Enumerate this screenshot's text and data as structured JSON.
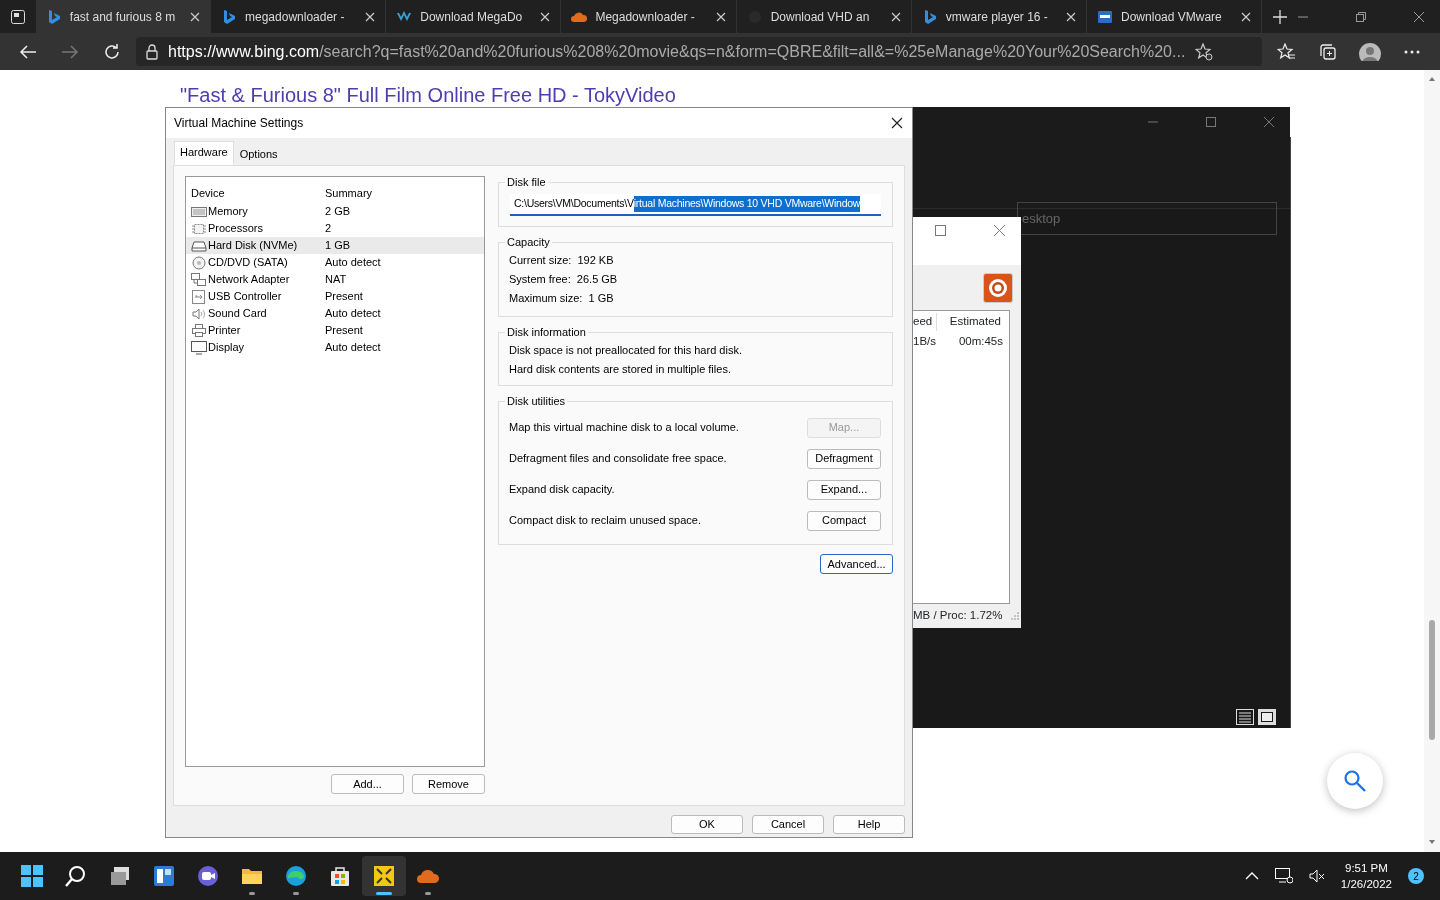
{
  "browser": {
    "tabs": [
      {
        "title": "fast and furious 8 m",
        "kind": "bing",
        "selected": true
      },
      {
        "title": "megadownloader -",
        "kind": "bing",
        "selected": false
      },
      {
        "title": "Download MegaDo",
        "kind": "wave",
        "selected": false
      },
      {
        "title": "Megadownloader -",
        "kind": "cloud",
        "selected": false
      },
      {
        "title": "Download VHD an",
        "kind": "blank",
        "selected": false
      },
      {
        "title": "vmware player 16 -",
        "kind": "bing",
        "selected": false
      },
      {
        "title": "Download VMware",
        "kind": "square",
        "selected": false
      }
    ],
    "address": {
      "host": "https://www.bing.com",
      "path": "/search?q=fast%20and%20furious%208%20movie&qs=n&form=QBRE&filt=all&=%25eManage%20Your%20Search%20..."
    }
  },
  "page": {
    "result_link": "\"Fast & Furious 8\" Full Film Online Free HD - TokyVideo"
  },
  "background_window": {
    "field_text": "esktop"
  },
  "downloader": {
    "columns": [
      "eed",
      "Estimated"
    ],
    "rows": [
      [
        "1B/s",
        "00m:45s"
      ]
    ],
    "status": "MB / Proc: 1.72%"
  },
  "dialog": {
    "title": "Virtual Machine Settings",
    "tabs": [
      {
        "label": "Hardware",
        "selected": true
      },
      {
        "label": "Options",
        "selected": false
      }
    ],
    "device_columns": [
      "Device",
      "Summary"
    ],
    "devices": [
      {
        "kind": "memory",
        "name": "Memory",
        "summary": "2 GB",
        "selected": false
      },
      {
        "kind": "cpu",
        "name": "Processors",
        "summary": "2",
        "selected": false
      },
      {
        "kind": "disk",
        "name": "Hard Disk (NVMe)",
        "summary": "1 GB",
        "selected": true
      },
      {
        "kind": "cd",
        "name": "CD/DVD (SATA)",
        "summary": "Auto detect",
        "selected": false
      },
      {
        "kind": "network",
        "name": "Network Adapter",
        "summary": "NAT",
        "selected": false
      },
      {
        "kind": "usb",
        "name": "USB Controller",
        "summary": "Present",
        "selected": false
      },
      {
        "kind": "sound",
        "name": "Sound Card",
        "summary": "Auto detect",
        "selected": false
      },
      {
        "kind": "printer",
        "name": "Printer",
        "summary": "Present",
        "selected": false
      },
      {
        "kind": "display",
        "name": "Display",
        "summary": "Auto detect",
        "selected": false
      }
    ],
    "list_buttons": [
      "Add...",
      "Remove"
    ],
    "disk_file": {
      "title": "Disk file",
      "value_unselected": "C:\\Users\\VM\\Documents\\V",
      "value_selected": "irtual Machines\\Windows 10 VHD VMware\\Window"
    },
    "capacity": {
      "title": "Capacity",
      "lines": [
        "Current size:  192 KB",
        "System free:  26.5 GB",
        "Maximum size:  1 GB"
      ]
    },
    "disk_information": {
      "title": "Disk information",
      "lines": [
        "Disk space is not preallocated for this hard disk.",
        "Hard disk contents are stored in multiple files."
      ]
    },
    "disk_utilities": {
      "title": "Disk utilities",
      "items": [
        {
          "text": "Map this virtual machine disk to a local volume.",
          "button": "Map...",
          "disabled": true
        },
        {
          "text": "Defragment files and consolidate free space.",
          "button": "Defragment",
          "disabled": false
        },
        {
          "text": "Expand disk capacity.",
          "button": "Expand...",
          "disabled": false
        },
        {
          "text": "Compact disk to reclaim unused space.",
          "button": "Compact",
          "disabled": false
        }
      ]
    },
    "advanced_button": "Advanced...",
    "footer_buttons": [
      "OK",
      "Cancel",
      "Help"
    ]
  },
  "taskbar": {
    "apps": [
      {
        "kind": "start",
        "running": false,
        "active": false
      },
      {
        "kind": "search",
        "running": false,
        "active": false
      },
      {
        "kind": "taskview",
        "running": false,
        "active": false
      },
      {
        "kind": "widgets",
        "running": false,
        "active": false
      },
      {
        "kind": "chat",
        "running": false,
        "active": false
      },
      {
        "kind": "explorer",
        "running": true,
        "active": false
      },
      {
        "kind": "edge",
        "running": true,
        "active": false
      },
      {
        "kind": "store",
        "running": false,
        "active": false
      },
      {
        "kind": "vmware",
        "running": true,
        "active": true
      },
      {
        "kind": "cloud",
        "running": true,
        "active": false
      }
    ],
    "time": "9:51 PM",
    "date": "1/26/2022",
    "notifications": "2"
  }
}
